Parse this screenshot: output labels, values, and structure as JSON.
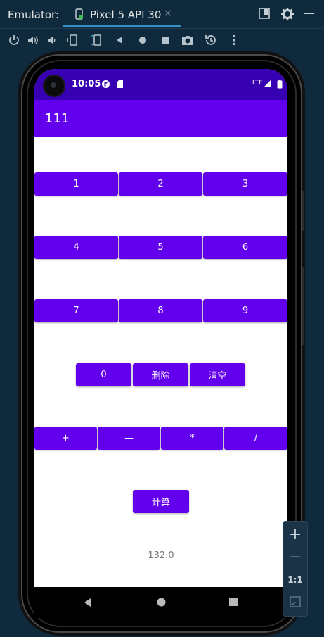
{
  "window": {
    "label": "Emulator:",
    "tab_title": "Pixel 5 API 30",
    "tab_close": "×",
    "right_icons": [
      "restore-icon",
      "gear-icon",
      "minimize-icon"
    ]
  },
  "toolbar": {
    "icons": [
      "power-icon",
      "volume-up-icon",
      "volume-down-icon",
      "rotate-left-icon",
      "rotate-right-icon",
      "back-icon",
      "home-icon",
      "overview-icon",
      "camera-icon",
      "snapshot-icon",
      "more-icon"
    ]
  },
  "phone": {
    "status": {
      "time": "10:05",
      "network": "LTE"
    },
    "app_title": "111",
    "rows": [
      {
        "buttons": [
          "1",
          "2",
          "3"
        ]
      },
      {
        "buttons": [
          "4",
          "5",
          "6"
        ]
      },
      {
        "buttons": [
          "7",
          "8",
          "9"
        ]
      },
      {
        "buttons": [
          "0",
          "删除",
          "清空"
        ]
      },
      {
        "buttons": [
          "+",
          "—",
          "*",
          "/"
        ]
      }
    ],
    "calc_button": "计算",
    "result": "132.0"
  },
  "zoom": {
    "plus": "+",
    "minus": "−",
    "one_to_one": "1:1"
  },
  "colors": {
    "primary": "#6200ee",
    "primary_dark": "#3700b3",
    "ide_bg": "#0f2a3c",
    "tab_underline": "#3592c4"
  }
}
